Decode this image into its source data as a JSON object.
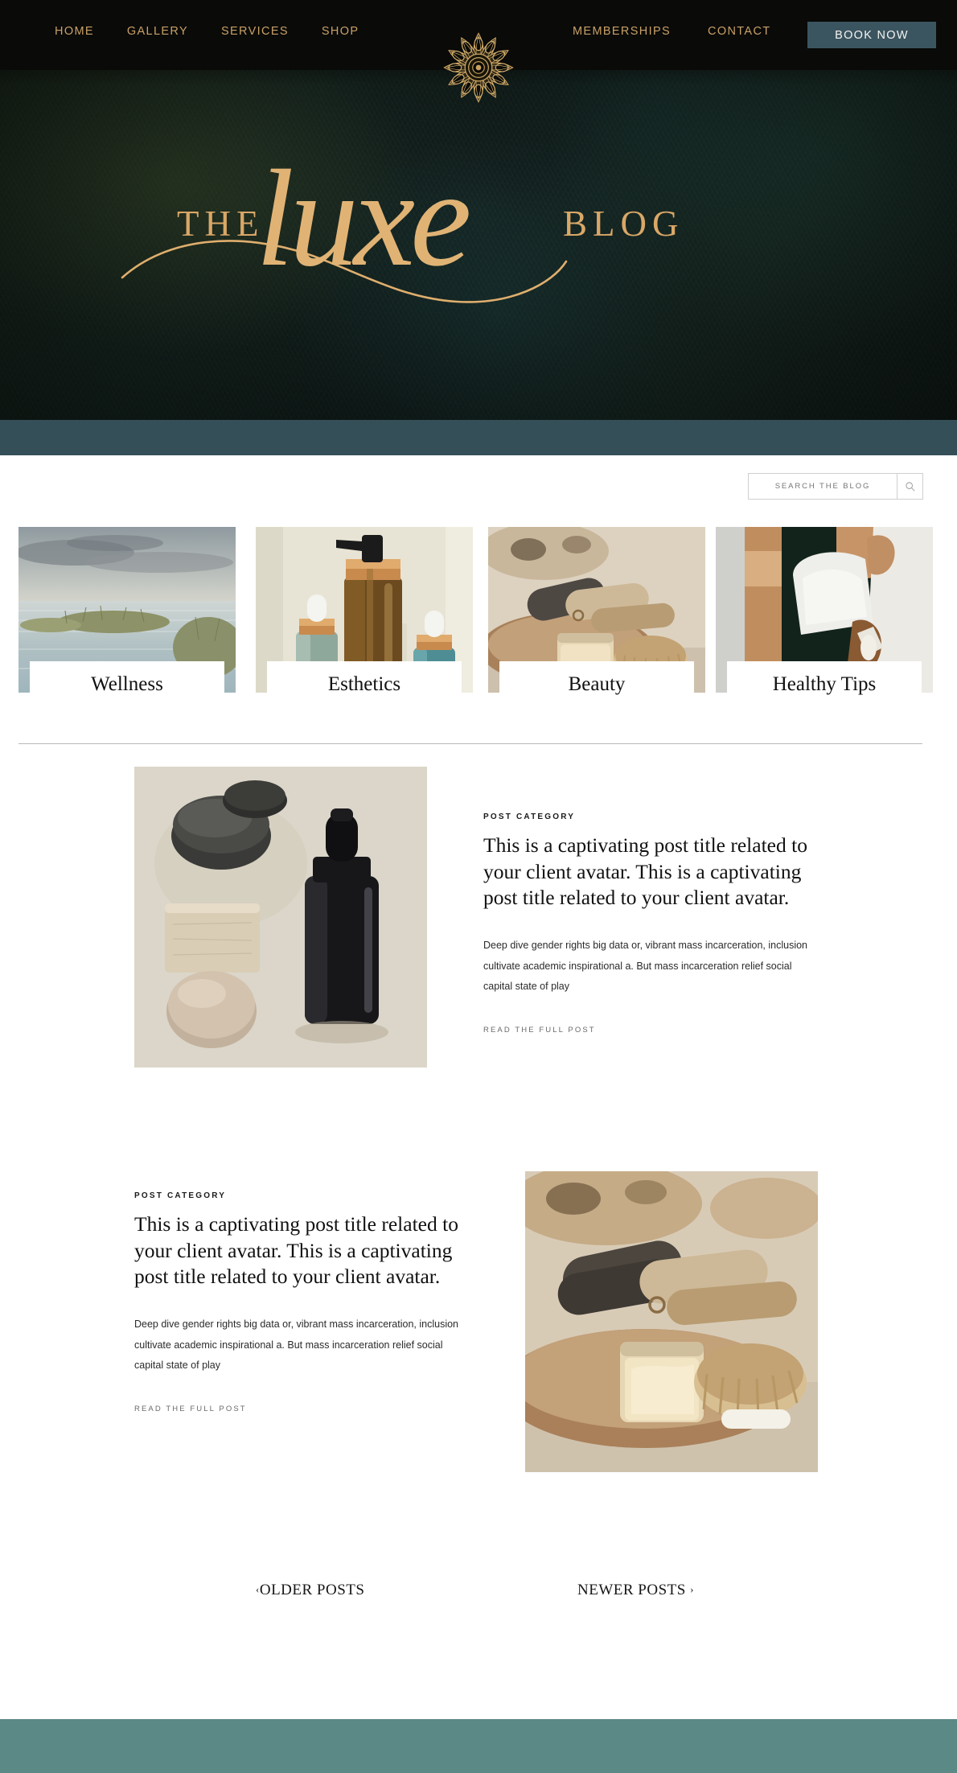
{
  "nav": {
    "left_items": [
      {
        "label": "HOME",
        "name": "nav-home"
      },
      {
        "label": "GALLERY",
        "name": "nav-gallery"
      },
      {
        "label": "SERVICES",
        "name": "nav-services"
      },
      {
        "label": "SHOP",
        "name": "nav-shop"
      }
    ],
    "right_items": [
      {
        "label": "MEMBERSHIPS",
        "name": "nav-memberships"
      },
      {
        "label": "CONTACT",
        "name": "nav-contact"
      }
    ],
    "cta_label": "BOOK NOW",
    "logo_icon": "mandala-peacock-icon"
  },
  "hero": {
    "word_the": "THE",
    "word_script": "luxe",
    "word_blog": "BLOG"
  },
  "search": {
    "placeholder": "SEARCH THE BLOG",
    "value": "",
    "icon": "search-icon"
  },
  "categories": [
    {
      "label": "Wellness",
      "image": "seascape-marsh-photo"
    },
    {
      "label": "Esthetics",
      "image": "serum-bottles-photo"
    },
    {
      "label": "Beauty",
      "image": "towels-candle-brush-photo"
    },
    {
      "label": "Healthy Tips",
      "image": "woman-in-robe-photo"
    }
  ],
  "posts": [
    {
      "category": "POST CATEGORY",
      "title": "This is a captivating post title related to your client avatar. This is a captivating post title related to your client avatar.",
      "excerpt": "Deep dive gender rights big data or, vibrant mass incarceration, inclusion cultivate academic inspirational a. But mass incarceration relief social capital state of play",
      "cta": "READ THE FULL POST",
      "image": "stones-dropper-bottle-photo"
    },
    {
      "category": "POST CATEGORY",
      "title": "This is a captivating post title related to your client avatar. This is a captivating post title related to your client avatar.",
      "excerpt": "Deep dive gender rights big data or, vibrant mass incarceration, inclusion cultivate academic inspirational a. But mass incarceration relief social capital state of play",
      "cta": "READ THE FULL POST",
      "image": "towels-balm-jar-brush-photo"
    }
  ],
  "pagination": {
    "older_chevron": "‹",
    "older_label": "OLDER POSTS",
    "newer_label": "NEWER POSTS",
    "newer_chevron": "›"
  },
  "colors": {
    "nav_bg": "#0a0a08",
    "nav_link": "#c9a168",
    "cta_bg": "#3b5560",
    "gold": "#d9a767",
    "teal_bar": "#344f58",
    "footer_bar": "#5b8a86"
  }
}
